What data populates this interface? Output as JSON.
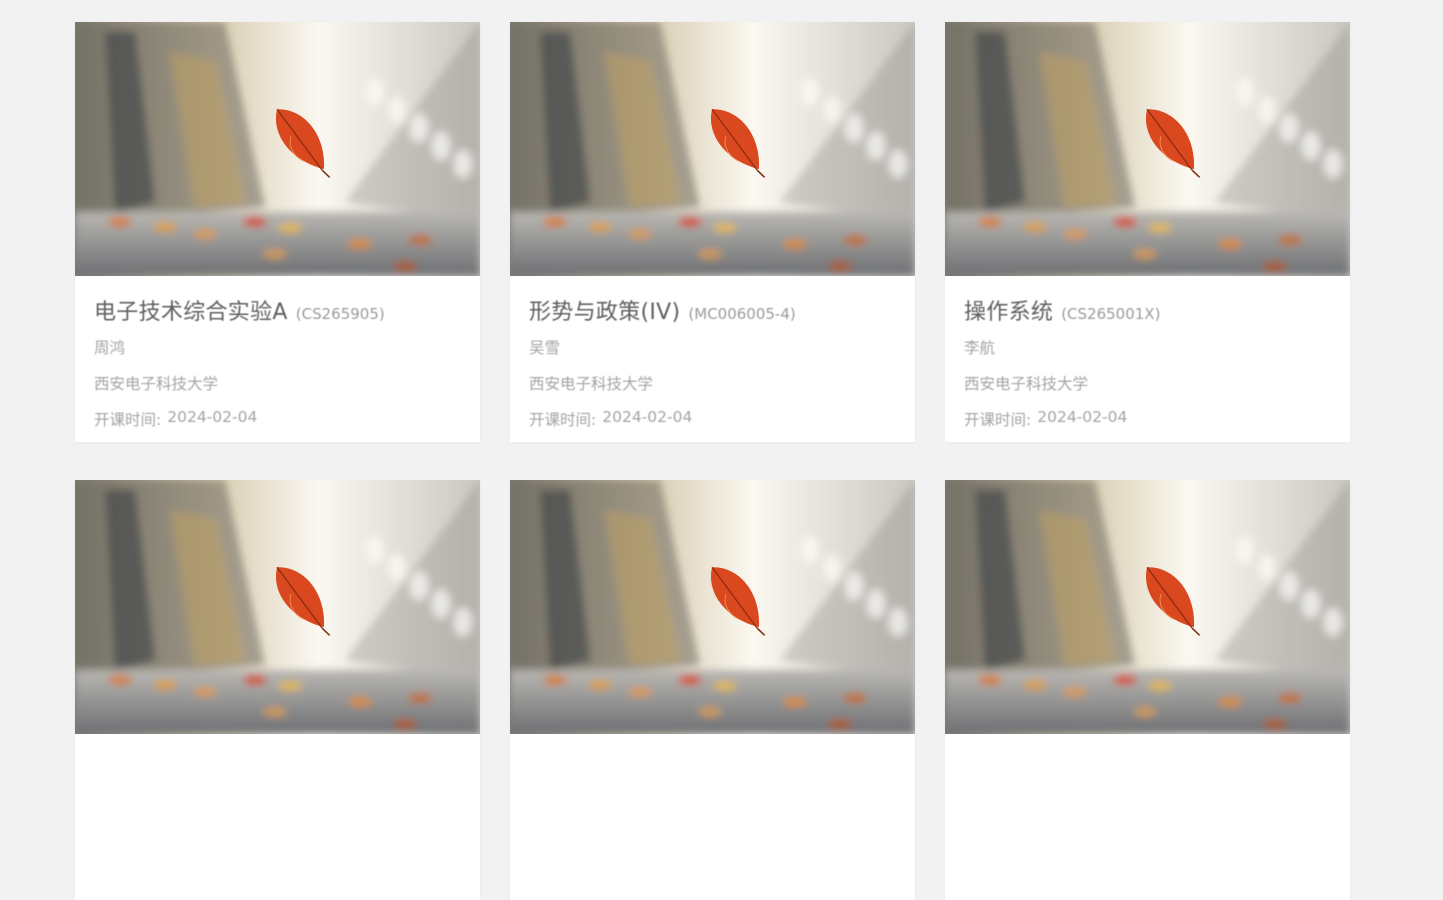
{
  "courses": [
    {
      "name": "电子技术综合实验A",
      "code": "(CS265905)",
      "teacher": "周鸿",
      "school": "西安电子科技大学",
      "date_label": "开课时间:",
      "date": "2024-02-04"
    },
    {
      "name": "形势与政策(IV)",
      "code": "(MC006005-4)",
      "teacher": "吴雪",
      "school": "西安电子科技大学",
      "date_label": "开课时间:",
      "date": "2024-02-04"
    },
    {
      "name": "操作系统",
      "code": "(CS265001X)",
      "teacher": "李航",
      "school": "西安电子科技大学",
      "date_label": "开课时间:",
      "date": "2024-02-04"
    },
    {
      "name": "",
      "code": "",
      "teacher": "",
      "school": "",
      "date_label": "",
      "date": ""
    },
    {
      "name": "",
      "code": "",
      "teacher": "",
      "school": "",
      "date_label": "",
      "date": ""
    },
    {
      "name": "",
      "code": "",
      "teacher": "",
      "school": "",
      "date_label": "",
      "date": ""
    }
  ],
  "colors": {
    "page_background": "#f2f2f3",
    "card_background": "#ffffff",
    "title_text": "#5f5f63",
    "meta_text": "#a4a4a8",
    "leaf_accent": "#d9481e"
  },
  "icons": {
    "cover": "autumn-leaf-cover-image"
  }
}
